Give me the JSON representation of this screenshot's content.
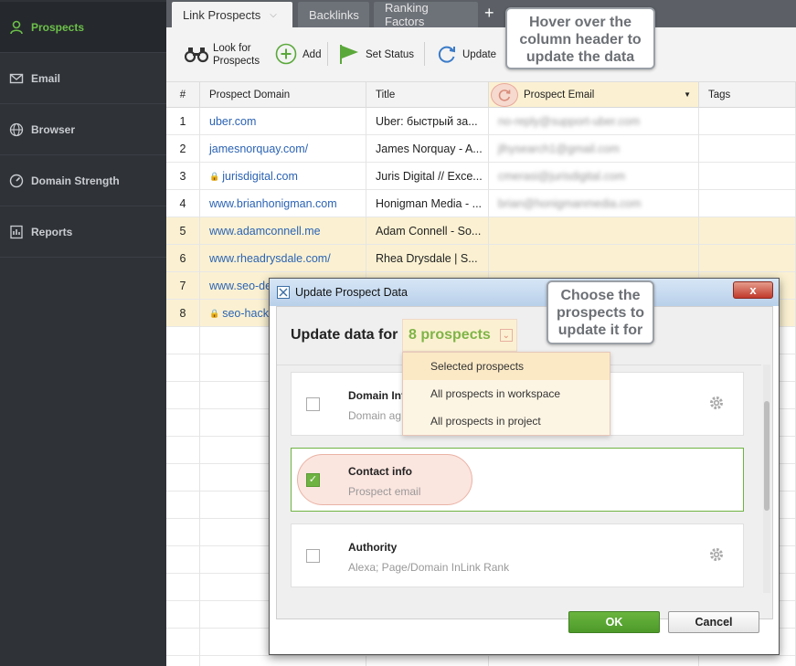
{
  "sidebar": {
    "items": [
      {
        "label": "Prospects",
        "icon": "user-icon",
        "active": true
      },
      {
        "label": "Email",
        "icon": "envelope-icon"
      },
      {
        "label": "Browser",
        "icon": "globe-icon"
      },
      {
        "label": "Domain Strength",
        "icon": "gauge-icon"
      },
      {
        "label": "Reports",
        "icon": "report-icon"
      }
    ]
  },
  "tabs": {
    "items": [
      {
        "label": "Link Prospects",
        "active": true
      },
      {
        "label": "Backlinks"
      },
      {
        "label": "Ranking Factors"
      }
    ],
    "add_label": "+"
  },
  "toolbar": {
    "look_for_line1": "Look for",
    "look_for_line2": "Prospects",
    "add": "Add",
    "set_status": "Set Status",
    "update": "Update"
  },
  "table": {
    "columns": [
      "#",
      "Prospect Domain",
      "Title",
      "Prospect Email",
      "Tags"
    ],
    "rows": [
      {
        "num": "1",
        "domain": "uber.com",
        "secure": false,
        "title": "Uber: быстрый за...",
        "email": "no-reply@support-uber.com",
        "highlight": false
      },
      {
        "num": "2",
        "domain": "jamesnorquay.com/",
        "secure": false,
        "title": "James Norquay - A...",
        "email": "jlhysearch1@gmail.com",
        "highlight": false
      },
      {
        "num": "3",
        "domain": "jurisdigital.com",
        "secure": true,
        "title": "Juris Digital // Exce...",
        "email": "cmerasi@jurisdigital.com",
        "highlight": false
      },
      {
        "num": "4",
        "domain": "www.brianhonigman.com",
        "secure": false,
        "title": "Honigman Media - ...",
        "email": "brian@honigmanmedia.com",
        "highlight": false
      },
      {
        "num": "5",
        "domain": "www.adamconnell.me",
        "secure": false,
        "title": "Adam Connell - So...",
        "email": "",
        "highlight": true
      },
      {
        "num": "6",
        "domain": "www.rheadrysdale.com/",
        "secure": false,
        "title": "Rhea Drysdale | S...",
        "email": "",
        "highlight": true
      },
      {
        "num": "7",
        "domain": "www.seo-de",
        "secure": false,
        "title": "",
        "email": "",
        "highlight": true
      },
      {
        "num": "8",
        "domain": "seo-hacke",
        "secure": true,
        "title": "",
        "email": "",
        "highlight": true
      }
    ]
  },
  "callouts": {
    "header_tip": "Hover over the column header to update the data",
    "scope_tip": "Choose the prospects to update it for"
  },
  "dialog": {
    "title": "Update Prospect Data",
    "close": "x",
    "update_label": "Update data for",
    "scope_value": "8 prospects",
    "scope_options": [
      "Selected prospects",
      "All prospects in workspace",
      "All prospects in project"
    ],
    "cards": [
      {
        "title": "Domain Inf",
        "subtitle": "Domain ag",
        "checked": false,
        "gear": true
      },
      {
        "title": "Contact info",
        "subtitle": "Prospect email",
        "checked": true,
        "gear": false
      },
      {
        "title": "Authority",
        "subtitle": "Alexa; Page/Domain InLink Rank",
        "checked": false,
        "gear": true
      }
    ],
    "ok": "OK",
    "cancel": "Cancel"
  },
  "colors": {
    "accent_green": "#6cc04a",
    "link_blue": "#2b63b4",
    "highlight_row": "#fbf1d2"
  }
}
